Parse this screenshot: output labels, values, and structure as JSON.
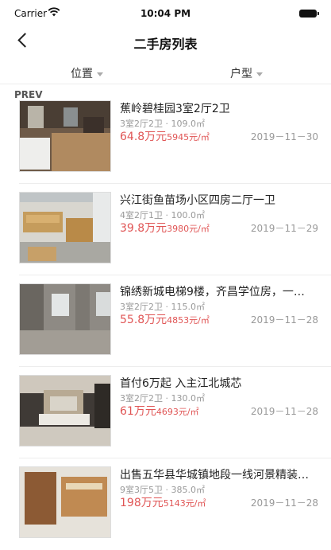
{
  "status_bar": {
    "carrier": "Carrier",
    "time": "10:04 PM"
  },
  "nav": {
    "title": "二手房列表"
  },
  "filters": {
    "location": "位置",
    "type": "户型"
  },
  "prev_label": "PREV",
  "listings": [
    {
      "title": "蕉岭碧桂园3室2厅2卫",
      "specs": "3室2厅2卫 · 109.0㎡",
      "price_total": "64.8万元",
      "price_unit": "5945元/㎡",
      "date": "2019－11－30"
    },
    {
      "title": "兴江街鱼苗场小区四房二厅一卫",
      "specs": "4室2厅1卫 · 100.0㎡",
      "price_total": "39.8万元",
      "price_unit": "3980元/㎡",
      "date": "2019－11－29"
    },
    {
      "title": "锦绣新城电梯9楼，齐昌学位房，一…",
      "specs": "3室2厅2卫 · 115.0㎡",
      "price_total": "55.8万元",
      "price_unit": "4853元/㎡",
      "date": "2019－11－28"
    },
    {
      "title": "首付6万起 入主江北城芯",
      "specs": "3室2厅2卫 · 130.0㎡",
      "price_total": "61万元",
      "price_unit": "4693元/㎡",
      "date": "2019－11－28"
    },
    {
      "title": "出售五华县华城镇地段一线河景精装…",
      "specs": "9室3厅5卫 · 385.0㎡",
      "price_total": "198万元",
      "price_unit": "5143元/㎡",
      "date": "2019－11－28"
    }
  ],
  "colors": {
    "price": "#e05555",
    "muted": "#999999",
    "divider": "#ededed"
  }
}
